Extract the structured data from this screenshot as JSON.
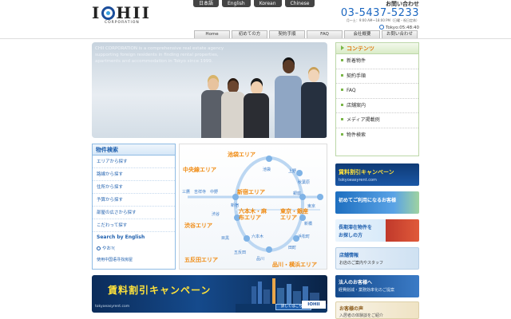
{
  "header": {
    "logo_text": "IOHII",
    "logo_sub": "CORPORATION",
    "languages": [
      "日本語",
      "English",
      "Korean",
      "Chinese"
    ],
    "contact_title": "お問い合わせ",
    "phone": "03-5437-5233",
    "hours": "月～土：9:00 AM～18:00 PM（日曜・祝日定休）",
    "clock": "Tokyo:05:48:40"
  },
  "nav": [
    "Home",
    "初めての方",
    "契約手順",
    "FAQ",
    "会社概要",
    "お問い合わせ"
  ],
  "hero": {
    "text": "CHII CORPORATION is a comprehensive real estate agency supporting foreign residents in finding rental properties, apartments and accommodation in Tokyo since 1999."
  },
  "contents": {
    "title": "コンテンツ",
    "items": [
      "新着物件",
      "契約手順",
      "FAQ",
      "店舗案内",
      "メディア掲載例",
      "物件検索"
    ]
  },
  "search": {
    "title": "物件検索",
    "items": [
      "エリアから探す",
      "路線から探す",
      "住所から探す",
      "予算から探す",
      "部屋の広さから探す",
      "こだわって探す"
    ],
    "english": "Search by English",
    "keyword": "やお?(",
    "note": "使用中国语寻找房屋"
  },
  "map": {
    "areas": [
      "池袋エリア",
      "中央線エリア",
      "新宿エリア",
      "六本木・麻布エリア",
      "東京・銀座エリア",
      "渋谷エリア",
      "五反田エリア",
      "品川・横浜エリア"
    ],
    "stations": [
      "池袋",
      "上野",
      "三鷹",
      "吉祥寺",
      "中野",
      "秋葉原",
      "新宿",
      "銀座",
      "渋谷",
      "東京",
      "六本木",
      "新橋",
      "目黒",
      "五反田",
      "浜松町",
      "品川",
      "田町"
    ]
  },
  "banners": {
    "big_title": "賃料割引キャンペーン",
    "big_url": "tokyoeasyrent.com",
    "big_button": "詳しくはこちら",
    "big_logo": "IOHII",
    "campaign_title": "賃料割引キャンペーン",
    "campaign_url": "tokyoeasyrent.com",
    "first_title": "初めてご利用になるお客様",
    "long_title": "長期滞在物件を",
    "long_sub": "お探しの方",
    "store_title": "店舗情報",
    "store_sub": "お店のご案内やスタッフ",
    "corp_title": "法人のお客様へ",
    "corp_sub": "経費削減・業務効率化のご提案",
    "voice_title": "お客様の声",
    "voice_sub": "入居者の体験談をご紹介"
  }
}
